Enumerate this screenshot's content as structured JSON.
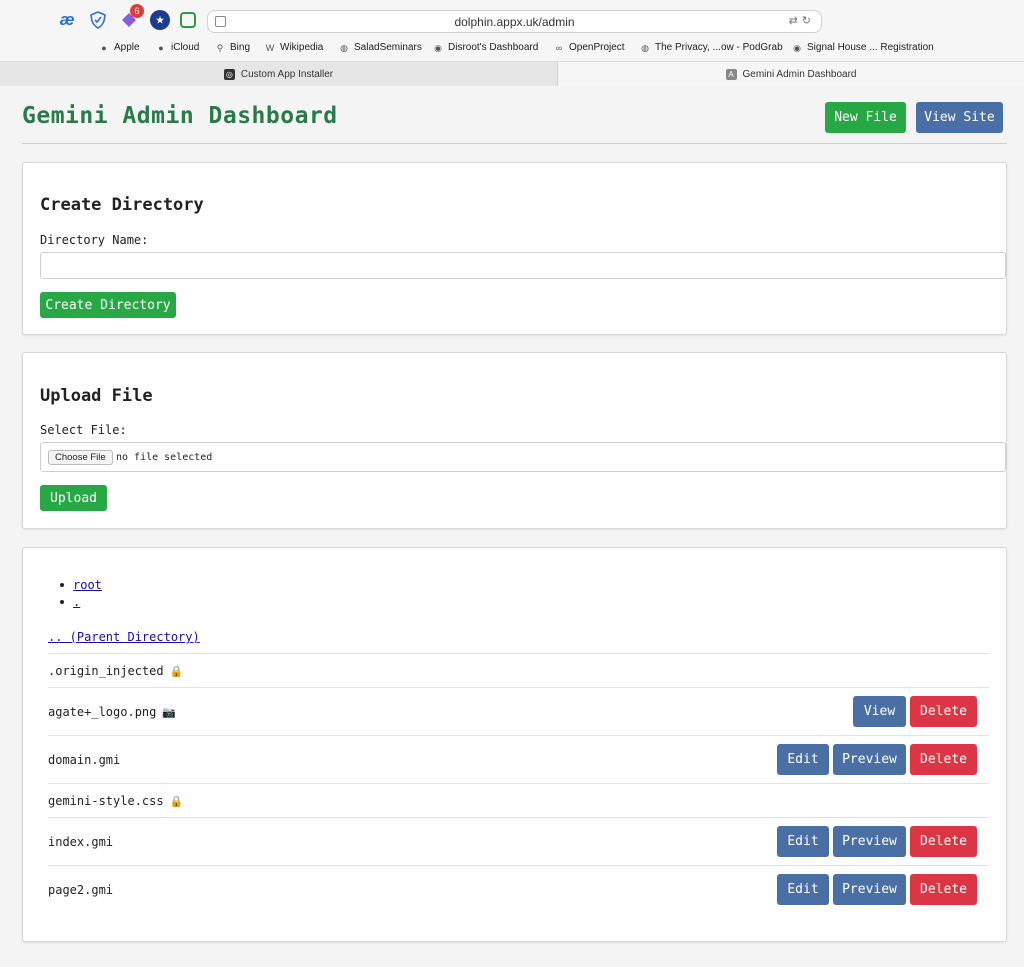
{
  "browser": {
    "url": "dolphin.appx.uk/admin",
    "extension_badge": "6",
    "bookmarks": [
      "Apple",
      "iCloud",
      "Bing",
      "Wikipedia",
      "SaladSeminars",
      "Disroot's Dashboard",
      "OpenProject",
      "The Privacy, ...ow - PodGrab",
      "Signal House ... Registration"
    ],
    "tabs": [
      {
        "label": "Custom App Installer",
        "active": false
      },
      {
        "label": "Gemini Admin Dashboard",
        "active": true
      }
    ]
  },
  "header": {
    "title": "Gemini Admin Dashboard",
    "new_file_label": "New File",
    "view_site_label": "View Site"
  },
  "create_directory": {
    "heading": "Create Directory",
    "label": "Directory Name:",
    "input_value": "",
    "button_label": "Create Directory"
  },
  "upload_file": {
    "heading": "Upload File",
    "label": "Select File:",
    "choose_label": "Choose File",
    "no_file_text": "no file selected",
    "button_label": "Upload"
  },
  "browser_list": {
    "breadcrumbs": [
      "root",
      "."
    ],
    "parent_link": ".. (Parent Directory)",
    "files": [
      {
        "name": ".origin_injected",
        "icon": "lock-icon",
        "glyph": "🔒",
        "actions": []
      },
      {
        "name": "agate+_logo.png",
        "icon": "camera-icon",
        "glyph": "📷",
        "actions": [
          "View",
          "Delete"
        ]
      },
      {
        "name": "domain.gmi",
        "icon": "",
        "glyph": "",
        "actions": [
          "Edit",
          "Preview",
          "Delete"
        ]
      },
      {
        "name": "gemini-style.css",
        "icon": "lock-icon",
        "glyph": "🔒",
        "actions": []
      },
      {
        "name": "index.gmi",
        "icon": "",
        "glyph": "",
        "actions": [
          "Edit",
          "Preview",
          "Delete"
        ]
      },
      {
        "name": "page2.gmi",
        "icon": "",
        "glyph": "",
        "actions": [
          "Edit",
          "Preview",
          "Delete"
        ]
      }
    ]
  },
  "colors": {
    "title_green": "#2b7a4b",
    "button_green": "#28a745",
    "button_blue": "#4a6fa5",
    "button_red": "#dc3545"
  }
}
